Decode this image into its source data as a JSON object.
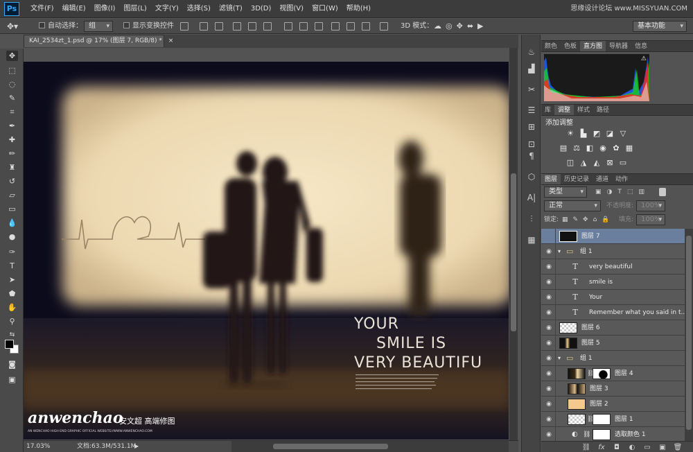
{
  "app": {
    "logo": "Ps",
    "watermark": "思缘设计论坛 www.MISSYUAN.COM"
  },
  "menu": [
    "文件(F)",
    "编辑(E)",
    "图像(I)",
    "图层(L)",
    "文字(Y)",
    "选择(S)",
    "滤镜(T)",
    "3D(D)",
    "视图(V)",
    "窗口(W)",
    "帮助(H)"
  ],
  "options": {
    "auto_select_label": "自动选择：",
    "auto_select_value": "组",
    "show_transform_label": "显示变换控件",
    "mode3d_label": "3D 模式：",
    "workspace": "基本功能"
  },
  "document": {
    "tab_title": "KAI_2534zt_1.psd @ 17% (图层 7, RGB/8) *",
    "zoom": "17.03%",
    "doc_size": "文档:63.3M/531.1M"
  },
  "artwork": {
    "headline": [
      "YOUR",
      "SMILE IS",
      "VERY BEAUTIFU"
    ],
    "brand": "anwenchao",
    "brand_cn": "安文超 高端修图",
    "brand_sub": "AN WENCHAO HIGH-END GRAPHIC OFFICIAL WEBSITE//WWW.ANWENCHAO.COM"
  },
  "panels": {
    "hist_tabs": [
      "颜色",
      "色板",
      "直方图",
      "导航器",
      "信息"
    ],
    "hist_active": "直方图",
    "adj_tabs": [
      "库",
      "调整",
      "样式",
      "路径"
    ],
    "adj_active": "调整",
    "adj_title": "添加调整",
    "layer_tabs": [
      "图层",
      "历史记录",
      "通道",
      "动作"
    ],
    "layer_active": "图层",
    "filter_kind": "类型",
    "blend_mode": "正常",
    "opacity_label": "不透明度:",
    "opacity_value": "100%",
    "lock_label": "锁定:",
    "fill_label": "填充:",
    "fill_value": "100%"
  },
  "layers": [
    {
      "name": "图层 7",
      "type": "pixel",
      "selected": true,
      "visible": false
    },
    {
      "name": "组 1",
      "type": "group",
      "visible": true,
      "expanded": true
    },
    {
      "name": "very beautiful",
      "type": "text",
      "visible": true
    },
    {
      "name": "smile is",
      "type": "text",
      "visible": true
    },
    {
      "name": "Your",
      "type": "text",
      "visible": true
    },
    {
      "name": "Remember what you said in t...",
      "type": "text",
      "visible": true
    },
    {
      "name": "图层 6",
      "type": "pixel",
      "visible": true
    },
    {
      "name": "图层 5",
      "type": "pixel",
      "visible": true
    },
    {
      "name": "组 1",
      "type": "group",
      "visible": true,
      "expanded": true
    },
    {
      "name": "图层 4",
      "type": "masked",
      "visible": true
    },
    {
      "name": "图层 3",
      "type": "pixel",
      "visible": true
    },
    {
      "name": "图层 2",
      "type": "pixel",
      "visible": true
    },
    {
      "name": "图层 1",
      "type": "masked",
      "visible": true
    },
    {
      "name": "选取颜色 1",
      "type": "adjustment",
      "visible": true
    }
  ]
}
